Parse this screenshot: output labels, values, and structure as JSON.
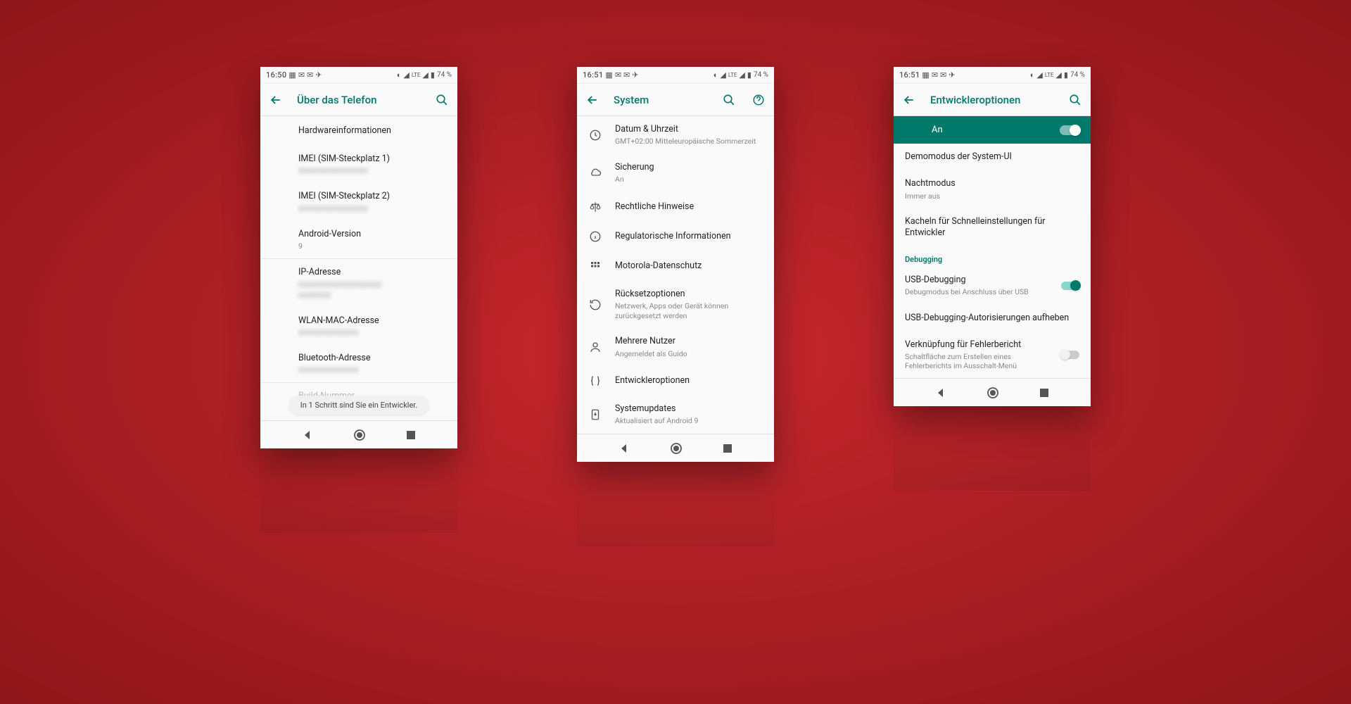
{
  "status": {
    "time1": "16:50",
    "time2": "16:51",
    "battery": "74 %",
    "lte": "LTE"
  },
  "screen1": {
    "title": "Über das Telefon",
    "items": [
      {
        "primary": "Hardwareinformationen"
      },
      {
        "primary": "IMEI (SIM-Steckplatz 1)",
        "blurred": true
      },
      {
        "primary": "IMEI (SIM-Steckplatz 2)",
        "blurred": true
      },
      {
        "primary": "Android-Version",
        "secondary": "9"
      }
    ],
    "items2": [
      {
        "primary": "IP-Adresse",
        "blurred": true,
        "lines": 2
      },
      {
        "primary": "WLAN-MAC-Adresse",
        "blurred": true
      },
      {
        "primary": "Bluetooth-Adresse",
        "blurred": true
      }
    ],
    "last_item_primary": "Build-Nummer",
    "toast": "In 1 Schritt sind Sie ein Entwickler."
  },
  "screen2": {
    "title": "System",
    "items": [
      {
        "primary": "Datum & Uhrzeit",
        "secondary": "GMT+02:00 Mitteleuropäische Sommerzeit",
        "icon": "clock"
      },
      {
        "primary": "Sicherung",
        "secondary": "An",
        "icon": "cloud"
      },
      {
        "primary": "Rechtliche Hinweise",
        "icon": "scale"
      },
      {
        "primary": "Regulatorische Informationen",
        "icon": "info"
      },
      {
        "primary": "Motorola-Datenschutz",
        "icon": "grid"
      },
      {
        "primary": "Rücksetzoptionen",
        "secondary": "Netzwerk, Apps oder Gerät können zurückgesetzt werden",
        "icon": "restore"
      },
      {
        "primary": "Mehrere Nutzer",
        "secondary": "Angemeldet als Guido",
        "icon": "person"
      },
      {
        "primary": "Entwickleroptionen",
        "icon": "braces"
      },
      {
        "primary": "Systemupdates",
        "secondary": "Aktualisiert auf Android 9",
        "icon": "update"
      }
    ]
  },
  "screen3": {
    "title": "Entwickleroptionen",
    "master_label": "An",
    "items": [
      {
        "primary": "Demomodus der System-UI"
      },
      {
        "primary": "Nachtmodus",
        "secondary": "Immer aus"
      },
      {
        "primary": "Kacheln für Schnelleinstellungen für Entwickler"
      }
    ],
    "section": "Debugging",
    "debug_items": [
      {
        "primary": "USB-Debugging",
        "secondary": "Debugmodus bei Anschluss über USB",
        "toggle": "on"
      },
      {
        "primary": "USB-Debugging-Autorisierungen aufheben"
      },
      {
        "primary": "Verknüpfung für Fehlerbericht",
        "secondary": "Schaltfläche zum Erstellen eines Fehlerberichts im Ausschalt-Menü",
        "toggle": "off"
      }
    ]
  }
}
